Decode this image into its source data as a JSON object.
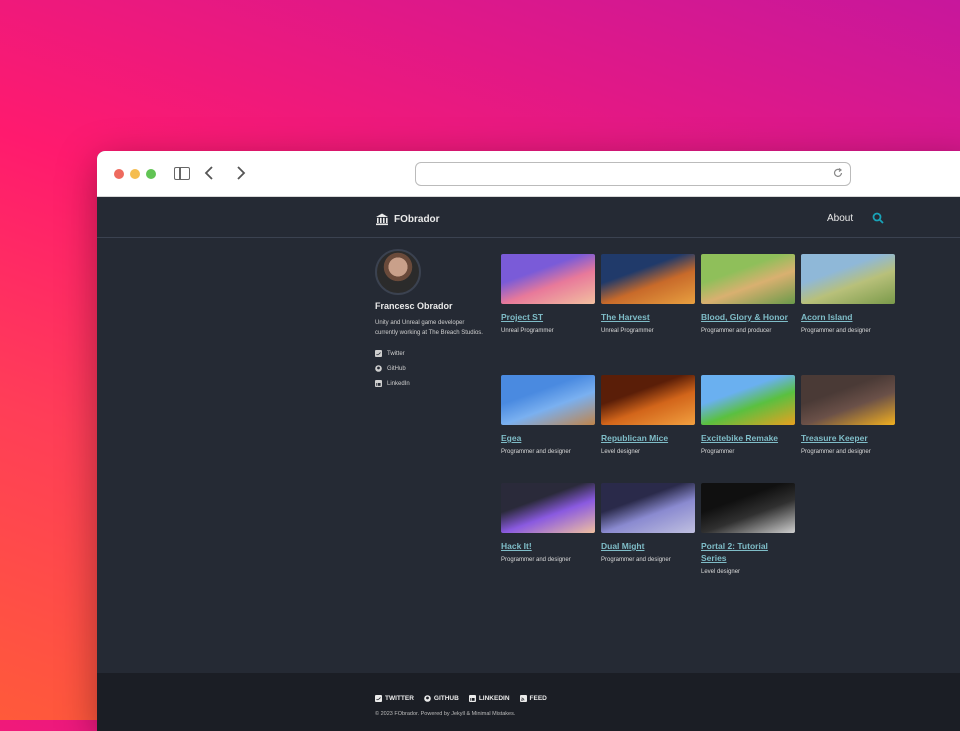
{
  "site": {
    "title": "FObrador",
    "nav_about": "About"
  },
  "author": {
    "name": "Francesc Obrador",
    "bio": "Unity and Unreal game developer currently working at The Breach Studios.",
    "links": [
      {
        "label": "Twitter",
        "icon": "twitter-icon"
      },
      {
        "label": "GitHub",
        "icon": "github-icon"
      },
      {
        "label": "LinkedIn",
        "icon": "linkedin-icon"
      }
    ]
  },
  "projects": [
    {
      "title": "Project ST",
      "role": "Unreal Programmer",
      "colors": [
        "#7a5bd8",
        "#e8799a",
        "#f2c0a0"
      ]
    },
    {
      "title": "The Harvest",
      "role": "Unreal Programmer",
      "colors": [
        "#203a6a",
        "#c86a2a",
        "#e8a040"
      ]
    },
    {
      "title": "Blood, Glory & Honor",
      "role": "Programmer and producer",
      "colors": [
        "#8fbf5a",
        "#d9b070",
        "#6a9a4a"
      ]
    },
    {
      "title": "Acorn Island",
      "role": "Programmer and designer",
      "colors": [
        "#8fb8d8",
        "#b8c07a",
        "#7a9a4a"
      ]
    },
    {
      "title": "Egea",
      "role": "Programmer and designer",
      "colors": [
        "#4a8ae0",
        "#7ab0f0",
        "#c0844a"
      ]
    },
    {
      "title": "Republican Mice",
      "role": "Level designer",
      "colors": [
        "#5a1e08",
        "#d2651a",
        "#f2a040"
      ]
    },
    {
      "title": "Excitebike Remake",
      "role": "Programmer",
      "colors": [
        "#6ab0f0",
        "#5ac040",
        "#e8a020"
      ]
    },
    {
      "title": "Treasure Keeper",
      "role": "Programmer and designer",
      "colors": [
        "#4a3a36",
        "#6a5048",
        "#f2b020"
      ]
    },
    {
      "title": "Hack It!",
      "role": "Programmer and designer",
      "colors": [
        "#2a2a3a",
        "#8a5ae0",
        "#f0c0a0"
      ]
    },
    {
      "title": "Dual Might",
      "role": "Programmer and designer",
      "colors": [
        "#2a2a4a",
        "#8a8ad0",
        "#c0c0e0"
      ]
    },
    {
      "title": "Portal 2: Tutorial Series",
      "role": "Level designer",
      "colors": [
        "#101010",
        "#303030",
        "#d0d0d0"
      ]
    }
  ],
  "footer": {
    "links": [
      {
        "label": "TWITTER",
        "icon": "twitter-icon"
      },
      {
        "label": "GITHUB",
        "icon": "github-icon"
      },
      {
        "label": "LINKEDIN",
        "icon": "linkedin-icon"
      },
      {
        "label": "FEED",
        "icon": "rss-icon"
      }
    ],
    "copyright": "© 2023 FObrador. Powered by Jekyll & Minimal Mistakes."
  },
  "colors": {
    "accent": "#7fbdc8",
    "background": "#252a34",
    "footer": "#1b1e25",
    "search": "#19a3b8"
  }
}
